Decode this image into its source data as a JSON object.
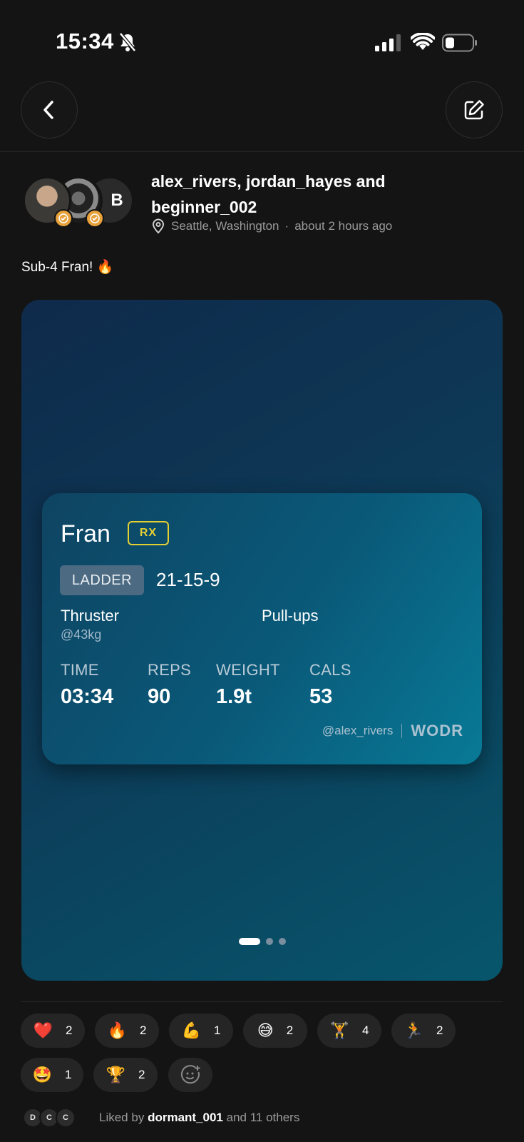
{
  "status_bar": {
    "time": "15:34"
  },
  "post": {
    "authors": "alex_rivers, jordan_hayes and beginner_002",
    "avatar_initial": "B",
    "location": "Seattle, Washington",
    "time_ago": "about 2 hours ago",
    "caption": "Sub-4 Fran! 🔥"
  },
  "wod": {
    "title": "Fran",
    "scaling": "RX",
    "format_tag": "LADDER",
    "scheme": "21-15-9",
    "movements": [
      {
        "name": "Thruster",
        "load": "@43kg"
      },
      {
        "name": "Pull-ups"
      }
    ],
    "stats": [
      {
        "label": "TIME",
        "value": "03:34"
      },
      {
        "label": "REPS",
        "value": "90"
      },
      {
        "label": "WEIGHT",
        "value": "1.9t"
      },
      {
        "label": "CALS",
        "value": "53"
      }
    ],
    "handle": "@alex_rivers",
    "brand": "WODR"
  },
  "carousel": {
    "slides": 3,
    "active": 0
  },
  "reactions": [
    {
      "emoji": "❤️",
      "count": "2"
    },
    {
      "emoji": "🔥",
      "count": "2"
    },
    {
      "emoji": "💪",
      "count": "1"
    },
    {
      "emoji": "😅",
      "count": "2"
    },
    {
      "emoji": "🏋️",
      "count": "4"
    },
    {
      "emoji": "🏃",
      "count": "2"
    },
    {
      "emoji": "🤩",
      "count": "1"
    },
    {
      "emoji": "🏆",
      "count": "2"
    }
  ],
  "likes": {
    "avatars": [
      "D",
      "C",
      "C"
    ],
    "prefix": "Liked by",
    "user": "dormant_001",
    "suffix": "and 11 others"
  },
  "colors": {
    "background": "#141414",
    "rx_badge": "#e4cf33",
    "verified_badge": "#e8a23c"
  }
}
